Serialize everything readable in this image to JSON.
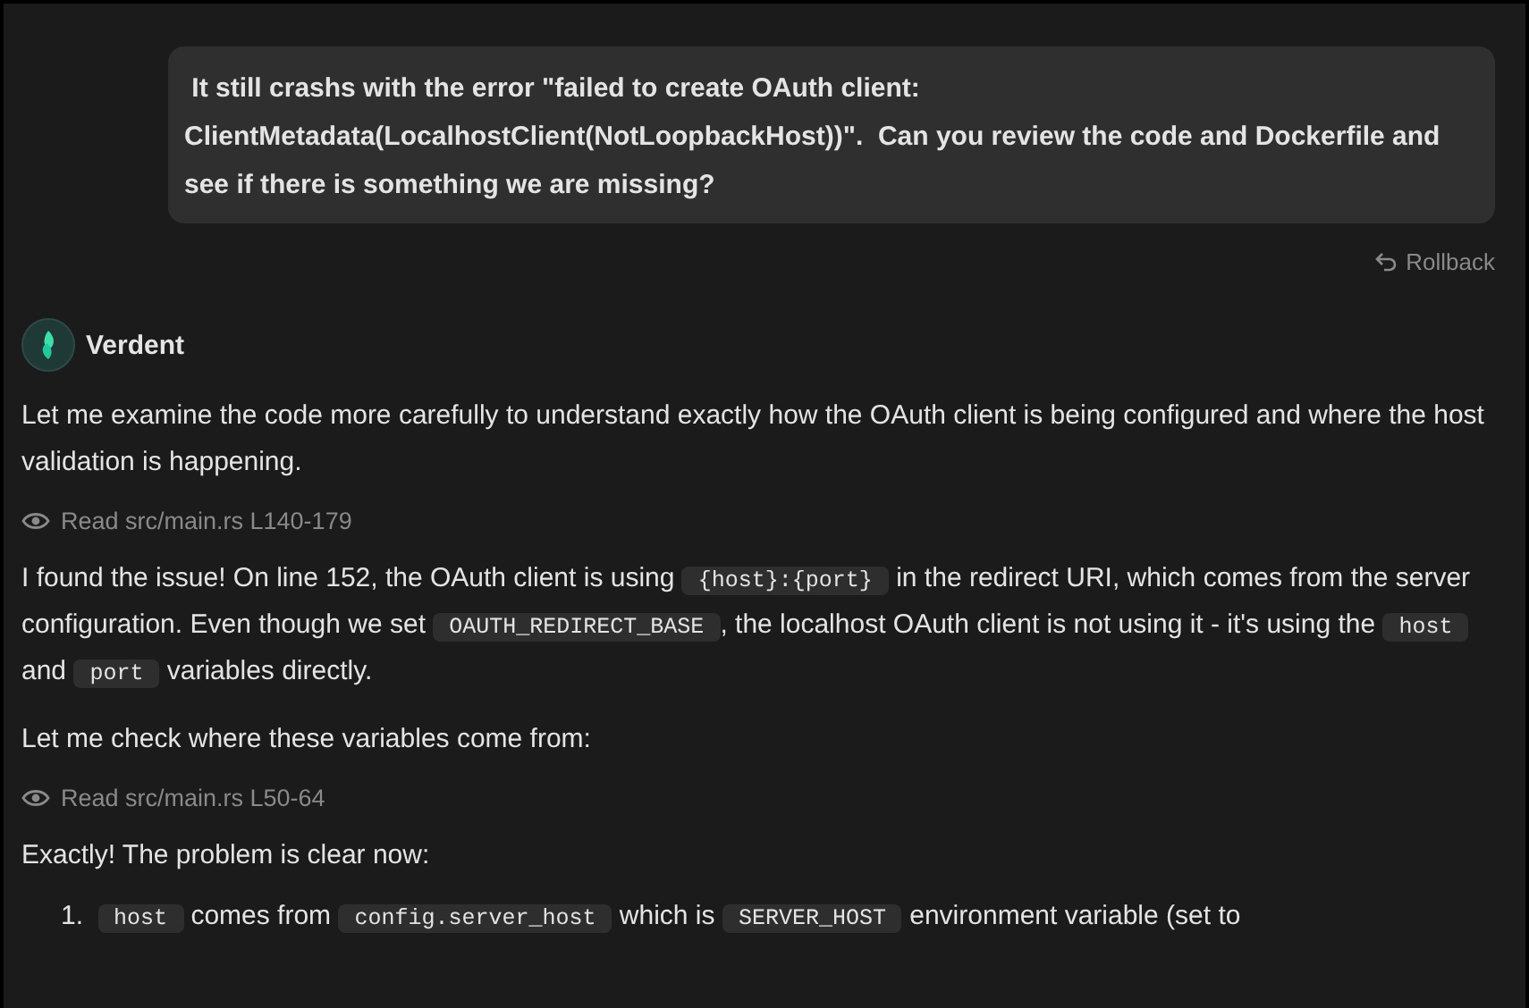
{
  "user_message": {
    "text": " It still crashs with the error \"failed to create OAuth client: ClientMetadata(LocalhostClient(NotLoopbackHost))\".  Can you review the code and Dockerfile and see if there is something we are missing?",
    "action": "Rollback"
  },
  "assistant": {
    "name": "Verdent"
  },
  "blocks": [
    {
      "kind": "paragraph",
      "parts": [
        {
          "kind": "text",
          "text": "Let me examine the code more carefully to understand exactly how the OAuth client is being configured and where the host validation is happening."
        }
      ]
    },
    {
      "kind": "tool",
      "text": "Read src/main.rs L140-179"
    },
    {
      "kind": "paragraph",
      "parts": [
        {
          "kind": "text",
          "text": "I found the issue! On line 152, the OAuth client is using "
        },
        {
          "kind": "code",
          "text": "{host}:{port}"
        },
        {
          "kind": "text",
          "text": " in the redirect URI, which comes from the server configuration. Even though we set "
        },
        {
          "kind": "code",
          "text": "OAUTH_REDIRECT_BASE"
        },
        {
          "kind": "text",
          "text": ", the localhost OAuth client is not using it - it's using the "
        },
        {
          "kind": "code",
          "text": "host"
        },
        {
          "kind": "text",
          "text": " and "
        },
        {
          "kind": "code",
          "text": "port"
        },
        {
          "kind": "text",
          "text": " variables directly."
        }
      ]
    },
    {
      "kind": "paragraph",
      "parts": [
        {
          "kind": "text",
          "text": "Let me check where these variables come from:"
        }
      ]
    },
    {
      "kind": "tool",
      "text": "Read src/main.rs L50-64"
    },
    {
      "kind": "paragraph",
      "parts": [
        {
          "kind": "text",
          "text": "Exactly! The problem is clear now:"
        }
      ]
    },
    {
      "kind": "list",
      "items": [
        {
          "marker": "1.",
          "parts": [
            {
              "kind": "code",
              "text": "host"
            },
            {
              "kind": "text",
              "text": " comes from "
            },
            {
              "kind": "code",
              "text": "config.server_host"
            },
            {
              "kind": "text",
              "text": " which is "
            },
            {
              "kind": "code",
              "text": "SERVER_HOST"
            },
            {
              "kind": "text",
              "text": " environment variable (set to"
            }
          ]
        }
      ]
    }
  ]
}
